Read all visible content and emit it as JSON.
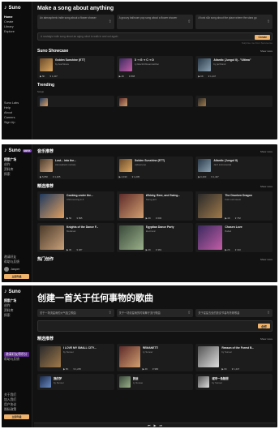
{
  "s1": {
    "brand": "Suno",
    "nav": [
      "Home",
      "Create",
      "Library",
      "Explore"
    ],
    "nav_bottom": [
      "Suno Labs",
      "Help",
      "About",
      "Careers",
      "Sign Up"
    ],
    "heading": "Make a song about anything",
    "suggestions": [
      "An atmospheric indie song about a flower shower",
      "A groovy ballroom pop song about a flower shower",
      "A funk r&b song about the place where the stars go"
    ],
    "prompt_placeholder": "A nostalgic indie song about an aging robot to walk in and out again",
    "create_label": "Create",
    "note": "Surprise me from Sunoverse",
    "showcase_title": "Suno Showcase",
    "showcase_more": "Show more",
    "cards": [
      {
        "title": "Golden Sunshine (ETT)",
        "sub": "by Ava Moore",
        "plays": "5K",
        "likes": "1,407"
      },
      {
        "title": "D ⇢ G ⇢ C ⇢ D",
        "sub": "by ElectricDreamcatcher",
        "plays": "4K",
        "likes": "898"
      },
      {
        "title": "Atlantic (Jungul II) - \"Ultima\"",
        "sub": "by jazzband",
        "plays": "6K",
        "likes": "1,447"
      }
    ],
    "trending_title": "Trending",
    "trending_sub": "Songs"
  },
  "s2": {
    "brand": "Suno",
    "badge": "BETA",
    "nav": [
      "探索广场",
      "创作",
      "资料库",
      "探索"
    ],
    "nav_bottom": [
      "邀请好友",
      "帮助与反馈"
    ],
    "user": "Jasper",
    "upgrade": "立即升级",
    "rec_title": "音乐推荐",
    "rec_more": "Show more",
    "rec_cards": [
      {
        "title": "Lost... into the...",
        "sub": "Atmospheric melody",
        "plays": "5,850",
        "likes": "1,205"
      },
      {
        "title": "Golden Sunshine (ETT)",
        "sub": "Upbeat pop",
        "plays": "4,190",
        "likes": "1,205"
      },
      {
        "title": "Atlantic (Jungul II)",
        "sub": "Jazz instrumental",
        "plays": "6,200",
        "likes": "1,447"
      }
    ],
    "sel_title": "精选推荐",
    "sel_more": "Show more",
    "sel_cards": [
      {
        "title": "Cooking under the...",
        "sub": "Chill evening lo-fi",
        "plays": "5K",
        "likes": "895"
      },
      {
        "title": "Whisky, Beer, and Swing...",
        "sub": "Swing jazz",
        "plays": "3K",
        "likes": "600"
      },
      {
        "title": "The Drunken Dragon",
        "sub": "Folk rock tavern",
        "plays": "4K",
        "likes": "752"
      },
      {
        "title": "Knights of the Dance F...",
        "sub": "Medieval",
        "plays": "3K",
        "likes": "487"
      },
      {
        "title": "Egyptian Dance Party",
        "sub": "Electronic",
        "plays": "2K",
        "likes": "381"
      },
      {
        "title": "Chosen Love",
        "sub": "Ballad",
        "plays": "2K",
        "likes": "310"
      }
    ],
    "hot_title": "热门创作",
    "hot_more": "Show more"
  },
  "s3": {
    "brand": "Suno",
    "nav": [
      "探索广场",
      "创作",
      "资料库",
      "探索"
    ],
    "nav_hl": "邀请好友得积分",
    "nav_mid": [
      "帮助与反馈"
    ],
    "nav_bottom": [
      "关于我们",
      "加入我们",
      "用户协议",
      "隐私政策"
    ],
    "upgrade": "立即升级",
    "heading": "创建一首关于任何事物的歌曲",
    "suggestions": [
      "关于一场流星雨的大气独立歌曲",
      "关于一场流星雨的时髦舞厅流行歌曲",
      "关于星星去处的放克节奏布鲁斯歌曲"
    ],
    "create_label": "创作",
    "sel_title": "精选推荐",
    "sel_more": "Show more",
    "cards": [
      {
        "title": "I LOVE MY SMALL CITY...",
        "sub": "by Sunoer",
        "plays": "5K",
        "likes": "1,205"
      },
      {
        "title": "REMANETTI",
        "sub": "by Sunoer",
        "plays": "4K",
        "likes": "980"
      },
      {
        "title": "Reason of the Forest B...",
        "sub": "by Sunoer",
        "plays": "6K",
        "likes": "1,447"
      },
      {
        "title": "我的梦",
        "sub": "by Sunoer",
        "plays": "3K",
        "likes": "602"
      },
      {
        "title": "旅途",
        "sub": "by Sunoer",
        "plays": "2K",
        "likes": "455"
      },
      {
        "title": "城市一角随想",
        "sub": "by Sunoer",
        "plays": "2K",
        "likes": "398"
      }
    ]
  }
}
